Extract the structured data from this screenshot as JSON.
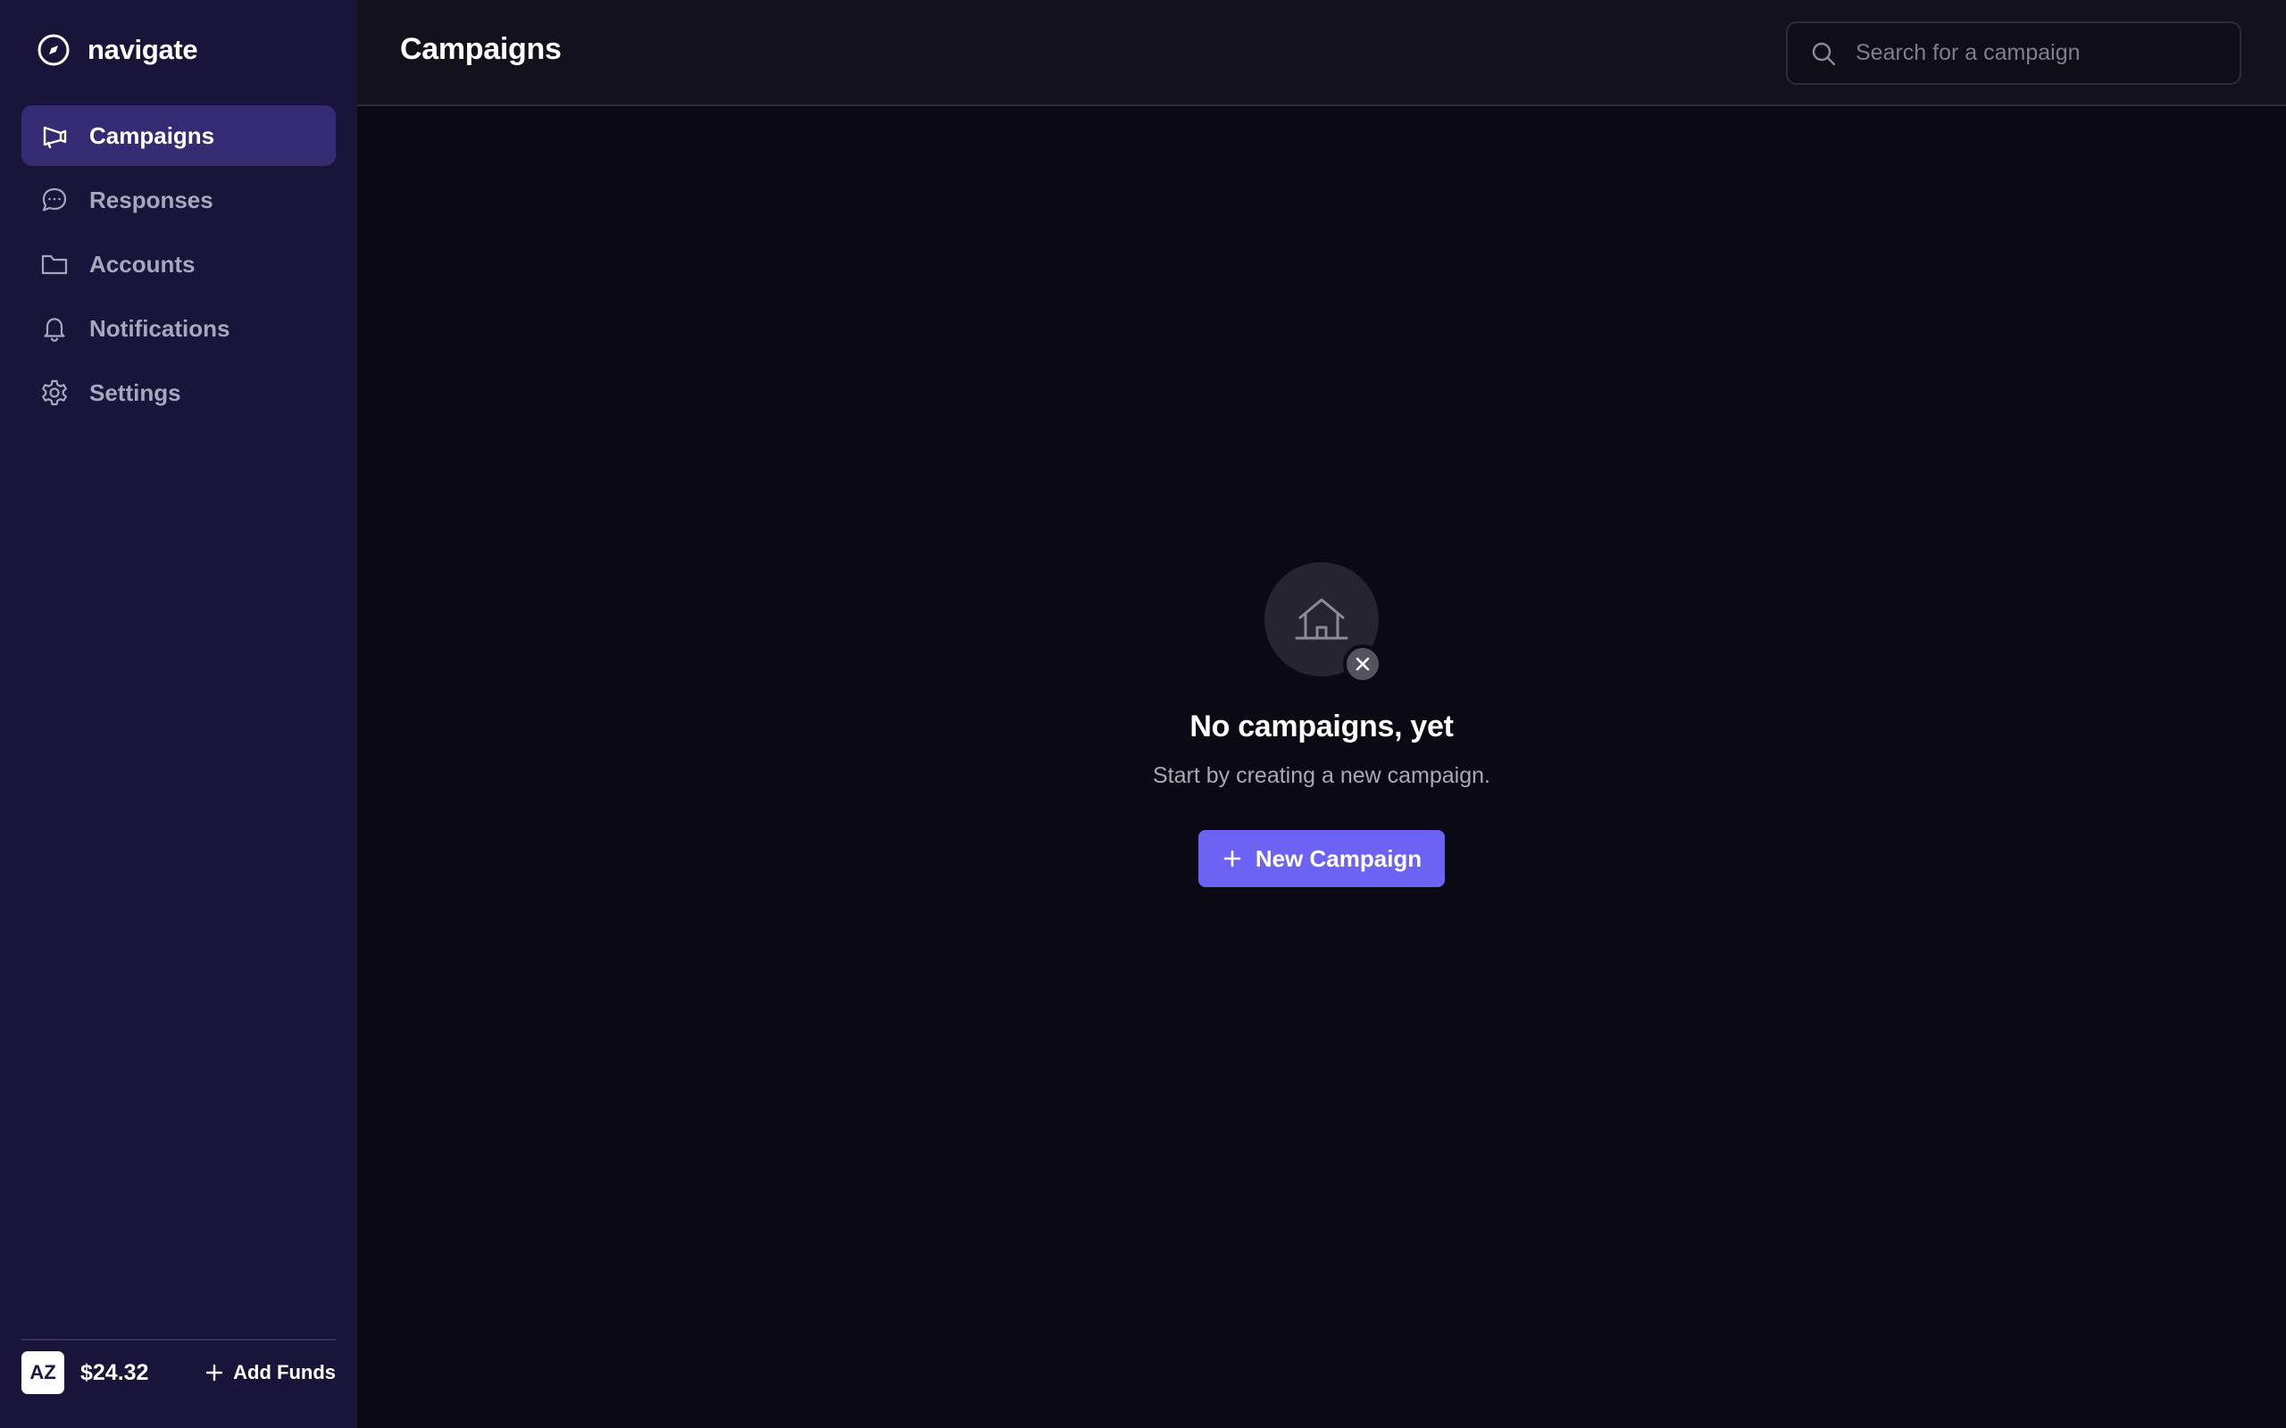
{
  "app": {
    "name": "navigate"
  },
  "sidebar": {
    "items": [
      {
        "label": "Campaigns",
        "icon": "megaphone-icon",
        "active": true
      },
      {
        "label": "Responses",
        "icon": "chat-bubble-icon",
        "active": false
      },
      {
        "label": "Accounts",
        "icon": "folder-icon",
        "active": false
      },
      {
        "label": "Notifications",
        "icon": "bell-icon",
        "active": false
      },
      {
        "label": "Settings",
        "icon": "gear-icon",
        "active": false
      }
    ],
    "footer": {
      "avatar_initials": "AZ",
      "balance": "$24.32",
      "add_funds_label": "Add Funds"
    }
  },
  "header": {
    "title": "Campaigns",
    "search_placeholder": "Search for a campaign"
  },
  "empty_state": {
    "icon": "house-icon",
    "badge_icon": "close-icon",
    "title": "No campaigns, yet",
    "subtitle": "Start by creating a new campaign.",
    "button_label": "New Campaign"
  },
  "colors": {
    "sidebar_bg": "#18143a",
    "active_item_bg": "#332c72",
    "accent": "#6c63f5",
    "main_bg": "#0b0a14"
  }
}
